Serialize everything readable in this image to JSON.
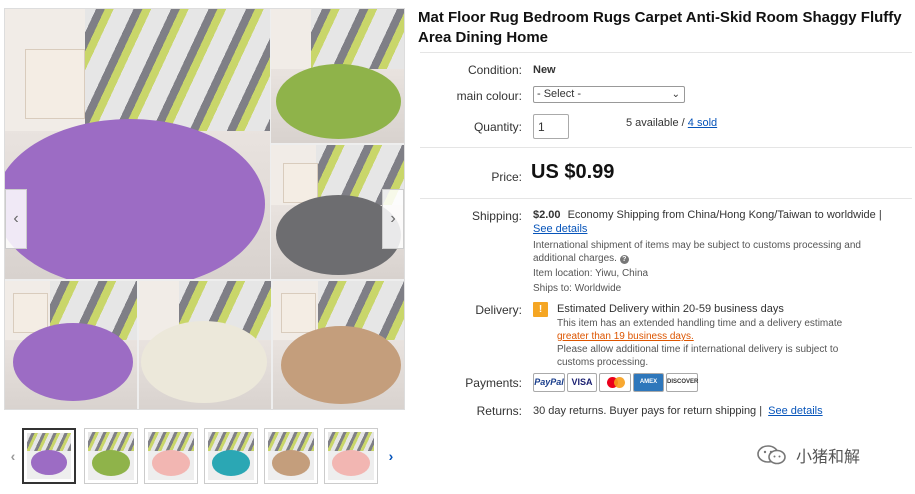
{
  "title": "Mat Floor Rug Bedroom Rugs Carpet Anti-Skid Room Shaggy Fluffy Area Dining Home",
  "condition": {
    "label": "Condition:",
    "value": "New"
  },
  "colour": {
    "label": "main colour:",
    "selected": "- Select -"
  },
  "quantity": {
    "label": "Quantity:",
    "value": "1",
    "available": "5 available /",
    "sold": "4 sold"
  },
  "price": {
    "label": "Price:",
    "value": "US $0.99"
  },
  "shipping": {
    "label": "Shipping:",
    "cost": "$2.00",
    "method": "Economy Shipping from China/Hong Kong/Taiwan to worldwide |",
    "details_link": "See details",
    "note_line1": "International shipment of items may be subject to customs processing and",
    "note_line2": "additional charges.",
    "location_label": "Item location:",
    "location": "Yiwu, China",
    "ships_to_label": "Ships to:",
    "ships_to": "Worldwide"
  },
  "delivery": {
    "label": "Delivery:",
    "estimate": "Estimated Delivery within 20-59 business days",
    "line1": "This item has an extended handling time and a delivery estimate",
    "line2": "greater than 19 business days.",
    "line3": "Please allow additional time if international delivery is subject to",
    "line4": "customs processing."
  },
  "payments": {
    "label": "Payments:",
    "methods": [
      "PayPal",
      "VISA",
      "MasterCard",
      "AMEX",
      "DISCOVER"
    ]
  },
  "returns": {
    "label": "Returns:",
    "text": "30 day returns. Buyer pays for return shipping |",
    "link": "See details"
  },
  "gallery": {
    "prev_icon": "chevron-left-icon",
    "next_icon": "chevron-right-icon",
    "colors": {
      "purple": "#9c6cc4",
      "green": "#8fb34a",
      "gray": "#6d6d70",
      "cream": "#ece8da",
      "tan": "#c49e7c",
      "pink": "#f2b6b2",
      "teal": "#2ba7b4"
    }
  },
  "watermark": {
    "text": "小猪和解"
  }
}
